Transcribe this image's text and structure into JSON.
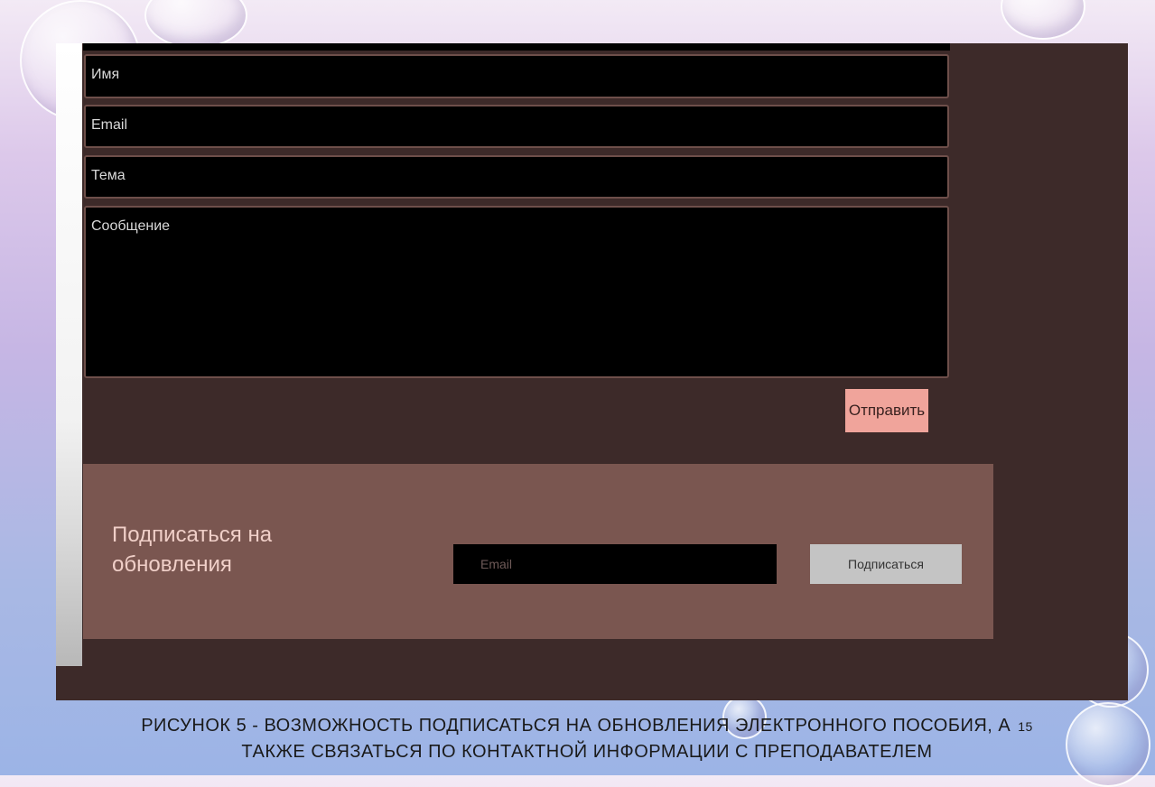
{
  "form": {
    "name_placeholder": "Имя",
    "email_placeholder": "Email",
    "subject_placeholder": "Тема",
    "message_placeholder": "Сообщение",
    "send_label": "Отправить"
  },
  "subscribe": {
    "title": "Подписаться на обновления",
    "email_placeholder": "Email",
    "button_label": "Подписаться"
  },
  "caption": {
    "line1": "РИСУНОК 5 - ВОЗМОЖНОСТЬ ПОДПИСАТЬСЯ НА ОБНОВЛЕНИЯ ЭЛЕКТРОННОГО ПОСОБИЯ, А",
    "line2": "ТАКЖЕ СВЯЗАТЬСЯ ПО КОНТАКТНОЙ ИНФОРМАЦИИ С ПРЕПОДАВАТЕЛЕМ",
    "page_number": "15"
  },
  "colors": {
    "page_bg": "#3d2a29",
    "field_bg": "#000000",
    "send_button": "#f0a49b",
    "subscribe_panel": "#7a5650",
    "subscribe_button": "#c4c4c4"
  }
}
